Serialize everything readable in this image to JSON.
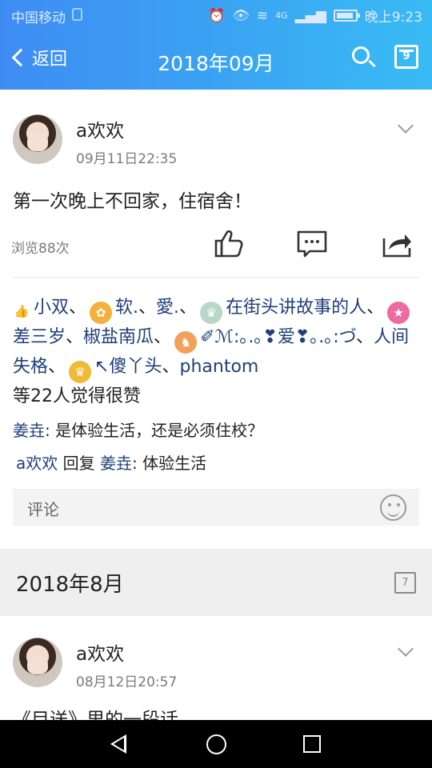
{
  "status": {
    "carrier": "中国移动",
    "network": "4G",
    "time": "晚上9:23"
  },
  "header": {
    "back_label": "返回",
    "title": "2018年09月",
    "calendar_day": "9"
  },
  "post1": {
    "user": "a欢欢",
    "time": "09月11日22:35",
    "content": "第一次晚上不回家，住宿舍！",
    "views": "浏览88次",
    "likes": {
      "names": [
        "小双",
        "软.",
        "愛.",
        "在街头讲故事的人",
        "差三岁",
        "椒盐南瓜",
        "✐ℳ:｡.｡❣爱❣｡.｡:づ",
        "人间失格",
        "↖傻丫头",
        "phantom"
      ],
      "summary": "等22人觉得很赞"
    },
    "comments": [
      {
        "name": "姜垚",
        "text": ": 是体验生活，还是必须住校？"
      },
      {
        "name": "a欢欢",
        "reply_word": "回复",
        "target": "姜垚",
        "text": ": 体验生活"
      }
    ],
    "comment_placeholder": "评论"
  },
  "section": {
    "month_label": "2018年8月",
    "calendar_day": "7"
  },
  "post2": {
    "user": "a欢欢",
    "time": "08月12日20:57",
    "content_partial": "《目送》里的一段话"
  },
  "colors": {
    "header_start": "#3e8cf3",
    "header_end": "#39bbf4",
    "name_link": "#1d3f7a"
  },
  "icons": [
    "back-chevron-icon",
    "search-icon",
    "calendar-icon",
    "thumbs-up-icon",
    "comment-icon",
    "share-icon",
    "chevron-down-icon",
    "emoji-icon",
    "nav-back-icon",
    "nav-home-icon",
    "nav-recent-icon"
  ]
}
